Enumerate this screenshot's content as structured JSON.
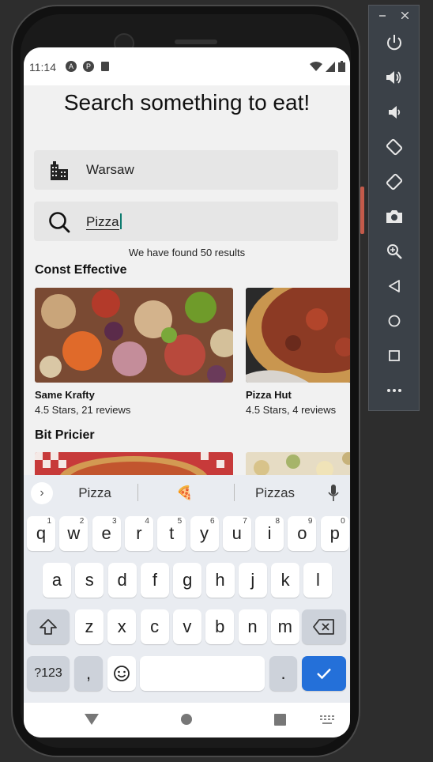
{
  "status": {
    "time": "11:14"
  },
  "page": {
    "title": "Search something to eat!",
    "location_value": "Warsaw",
    "search_value": "Pizza",
    "results_text": "We have found 50 results"
  },
  "sections": [
    {
      "title": "Const Effective",
      "cards": [
        {
          "name": "Same Krafty",
          "rating": "4.5 Stars, 21 reviews"
        },
        {
          "name": "Pizza Hut",
          "rating": "4.5 Stars, 4 reviews"
        }
      ]
    },
    {
      "title": "Bit Pricier"
    }
  ],
  "keyboard": {
    "suggestions": [
      "Pizza",
      "🍕",
      "Pizzas"
    ],
    "row1": [
      "q",
      "w",
      "e",
      "r",
      "t",
      "y",
      "u",
      "i",
      "o",
      "p"
    ],
    "row1_hints": [
      "1",
      "2",
      "3",
      "4",
      "5",
      "6",
      "7",
      "8",
      "9",
      "0"
    ],
    "row2": [
      "a",
      "s",
      "d",
      "f",
      "g",
      "h",
      "j",
      "k",
      "l"
    ],
    "row3": [
      "z",
      "x",
      "c",
      "v",
      "b",
      "n",
      "m"
    ],
    "symbols_label": "?123",
    "comma": ",",
    "period": "."
  },
  "colors": {
    "accent": "#2470d9",
    "caret": "#0d7b6f"
  },
  "icons": [
    "city-icon",
    "search-icon",
    "mic-icon",
    "shift-icon",
    "backspace-icon",
    "emoji-icon",
    "check-icon",
    "power-icon",
    "volume-up-icon",
    "volume-down-icon",
    "rotate-left-icon",
    "rotate-right-icon",
    "camera-icon",
    "zoom-icon",
    "back-icon",
    "home-icon",
    "overview-icon",
    "more-icon"
  ]
}
